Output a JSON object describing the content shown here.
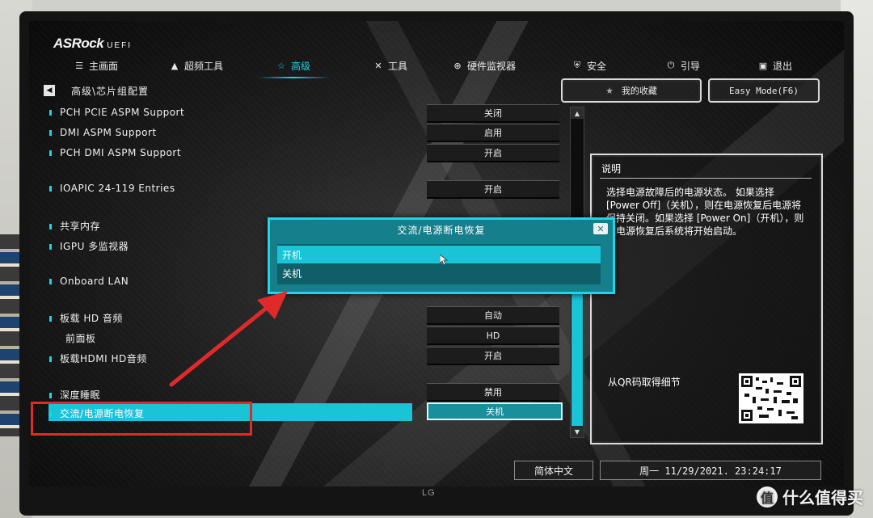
{
  "brand": {
    "name": "ASRock",
    "suffix": "UEFI"
  },
  "nav_tabs": [
    {
      "label": "主画面",
      "icon": "list-icon"
    },
    {
      "label": "超频工具",
      "icon": "rocket-icon"
    },
    {
      "label": "高级",
      "icon": "star-icon",
      "active": true
    },
    {
      "label": "工具",
      "icon": "tools-icon"
    },
    {
      "label": "硬件监视器",
      "icon": "crosshair-icon"
    },
    {
      "label": "安全",
      "icon": "shield-icon"
    },
    {
      "label": "引导",
      "icon": "power-icon"
    },
    {
      "label": "退出",
      "icon": "exit-icon"
    }
  ],
  "breadcrumb": "高级\\芯片组配置",
  "favorites_label": "我的收藏",
  "easy_mode_label": "Easy Mode(F6)",
  "settings": [
    {
      "label": "PCH PCIE ASPM Support",
      "value": "关闭"
    },
    {
      "label": "DMI ASPM Support",
      "value": "启用"
    },
    {
      "label": "PCH DMI ASPM Support",
      "value": "开启"
    },
    {
      "label": "IOAPIC 24-119 Entries",
      "value": "开启"
    },
    {
      "label": "共享内存",
      "value": ""
    },
    {
      "label": "IGPU 多监视器",
      "value": ""
    },
    {
      "label": "Onboard LAN",
      "value": ""
    },
    {
      "label": "板载 HD 音频",
      "value": "自动"
    },
    {
      "label": "前面板",
      "value": "HD"
    },
    {
      "label": "板载HDMI HD音频",
      "value": "开启"
    },
    {
      "label": "深度睡眠",
      "value": "禁用"
    },
    {
      "label": "交流/电源断电恢复",
      "value": "关机",
      "selected": true
    }
  ],
  "description": {
    "title": "说明",
    "body": "选择电源故障后的电源状态。 如果选择 [Power Off]（关机），则在电源恢复后电源将保持关闭。如果选择 [Power On]（开机），则在电源恢复后系统将开始启动。",
    "qr_label": "从QR码取得细节"
  },
  "popup": {
    "title": "交流/电源断电恢复",
    "options": [
      "开机",
      "关机"
    ],
    "highlighted_index": 0
  },
  "footer": {
    "language": "简体中文",
    "datetime": "周一 11/29/2021. 23:24:17"
  },
  "monitor_brand": "LG",
  "watermark": {
    "badge": "值",
    "text": "什么值得买"
  },
  "colors": {
    "accent": "#1fd3e8",
    "selection": "#18c4d6",
    "popup_bg": "#167f8c",
    "annotation": "#e02a2a"
  }
}
